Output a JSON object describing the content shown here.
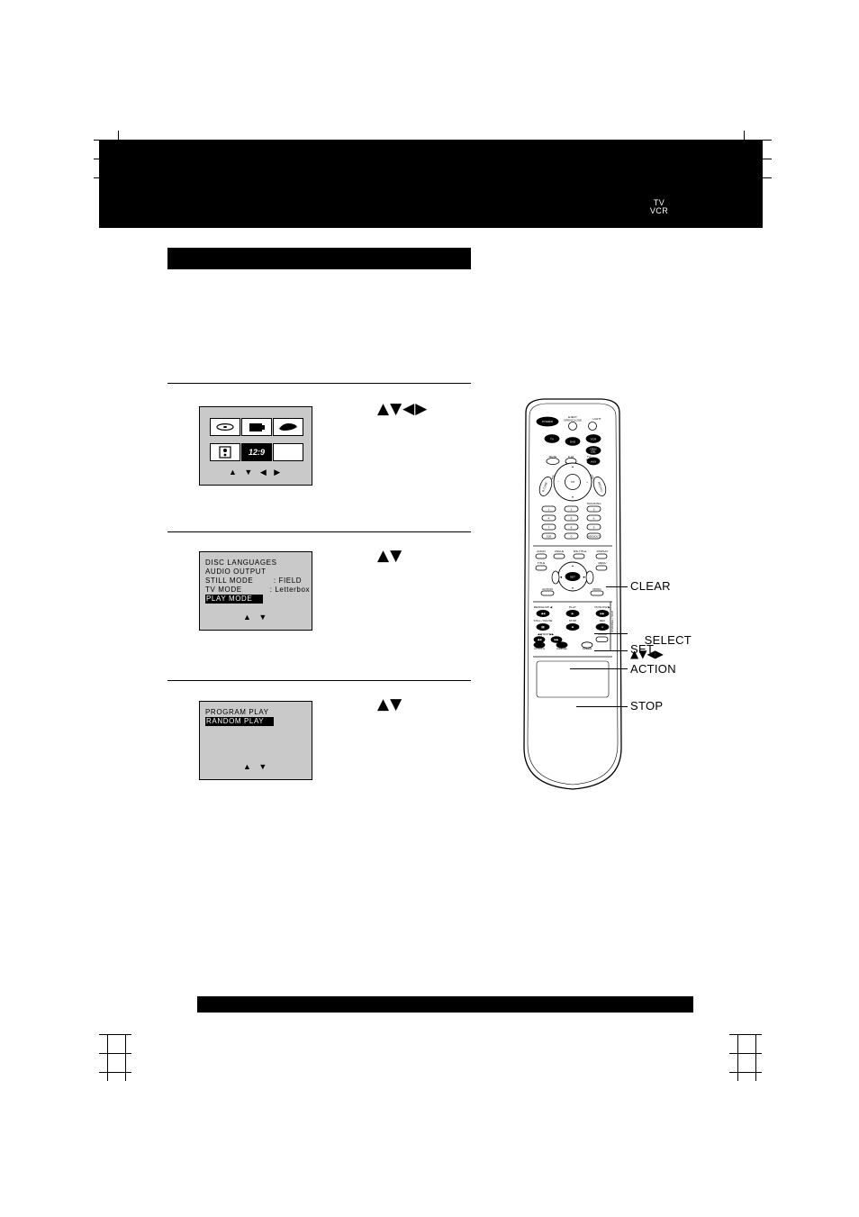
{
  "page": {
    "top_band_label": "TV\nVCR",
    "tv_vcr_line1": "TV",
    "tv_vcr_line2": "VCR"
  },
  "steps": [
    {
      "id": "step-1",
      "keys": "▲▼◀▶",
      "osd": {
        "type": "icon-grid",
        "icons": [
          "disc-icon",
          "tv-icon",
          "disc-oval-icon",
          "speaker-icon",
          "aspect-ratio-icon",
          "blank-icon"
        ],
        "aspect_label": "12:9",
        "arrows": "▲ ▼ ◀ ▶"
      }
    },
    {
      "id": "step-2",
      "keys": "▲▼",
      "osd": {
        "type": "menu",
        "lines": [
          "DISC LANGUAGES",
          "AUDIO OUTPUT",
          "STILL MODE        : FIELD",
          "TV MODE           : Letterbox"
        ],
        "highlight": "PLAY MODE",
        "arrows": "▲ ▼"
      }
    },
    {
      "id": "step-3",
      "keys": "▲▼",
      "osd": {
        "type": "menu",
        "lines": [
          "PROGRAM PLAY"
        ],
        "highlight": "RANDOM PLAY",
        "arrows": "▲ ▼"
      }
    }
  ],
  "callouts": [
    {
      "id": "callout-clear",
      "label": "CLEAR",
      "sub": ""
    },
    {
      "id": "callout-select",
      "label": "SELECT",
      "sub": "▲▼◀▶"
    },
    {
      "id": "callout-set",
      "label": "SET",
      "sub": ""
    },
    {
      "id": "callout-action",
      "label": "ACTION",
      "sub": ""
    },
    {
      "id": "callout-stop",
      "label": "STOP",
      "sub": ""
    }
  ],
  "remote": {
    "name": "remote-control",
    "top_buttons": [
      "POWER",
      "EJECT\nOPEN/CLOSE",
      "LIGHT"
    ],
    "mode_buttons": [
      "TV",
      "DVD",
      "VCR",
      "DBS/\nCBL",
      "AUX"
    ],
    "row_mute": [
      "MUTE",
      "C.10",
      "TV/\nVCR"
    ],
    "ring_labels": [
      "CH",
      "VOL",
      "VOL",
      "CH"
    ],
    "left_label": "R-TUNE",
    "right_label": "RECALL",
    "numeric": [
      "1",
      "2",
      "3",
      "4",
      "5",
      "6",
      "7",
      "8",
      "9",
      "100",
      "0",
      "ADD/DLT"
    ],
    "tracking_label": "TRACKING",
    "mid_row": [
      "AUDIO",
      "ANGLE",
      "R/S-TITLE",
      "DISPLAY"
    ],
    "mid_row2": [
      "TITLE",
      "",
      "",
      "MENU"
    ],
    "center_buttons": [
      "ACTION",
      "PROG"
    ],
    "set_label": "SET",
    "transport_row1": [
      "REW/SLOW ◀",
      "PLAY",
      "FF/SLOW ▶"
    ],
    "transport_row2": [
      "STILL / PAUSE",
      "STOP",
      "REC"
    ],
    "transport_row3": [
      "SKIP ◀◀",
      "SKIP ▶▶",
      "ZOOM"
    ],
    "bottom_row": [
      "CH RTN",
      "CANCEL",
      "SPEED"
    ],
    "side_label": "CHANNEL / SKIP"
  }
}
